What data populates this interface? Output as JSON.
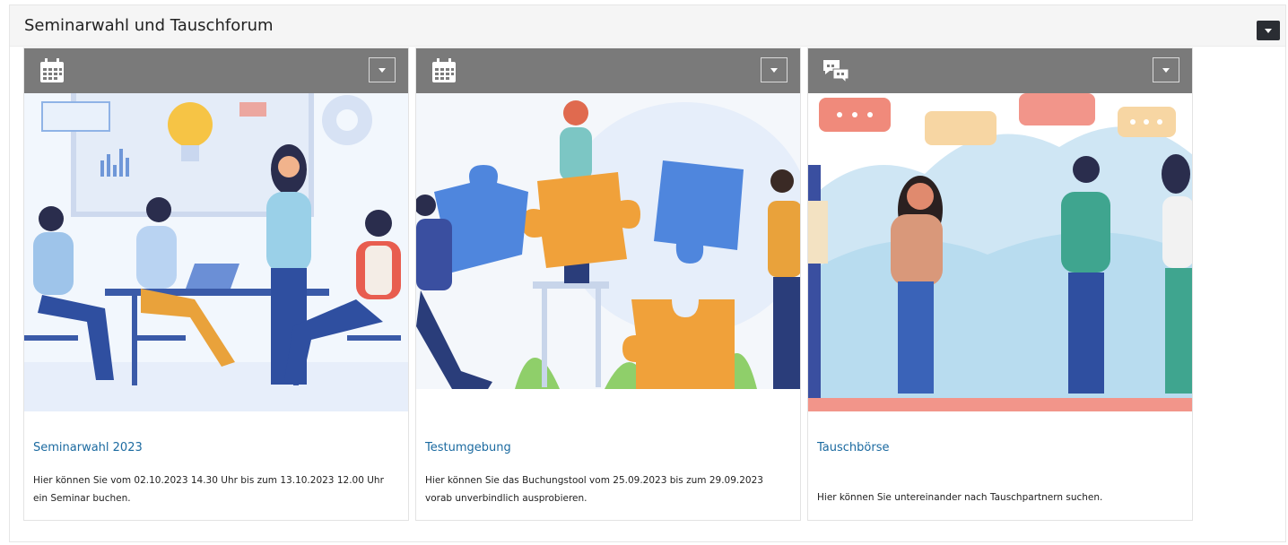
{
  "panel": {
    "title": "Seminarwahl und Tauschforum"
  },
  "cards": [
    {
      "title": "Seminarwahl 2023",
      "description": "Hier können Sie vom 02.10.2023 14.30 Uhr bis zum 13.10.2023 12.00 Uhr ein Seminar buchen.",
      "type_icon": "calendar-icon"
    },
    {
      "title": "Testumgebung",
      "description": "Hier können Sie das Buchungstool vom 25.09.2023 bis zum 29.09.2023 vorab unverbindlich ausprobieren.",
      "type_icon": "calendar-icon"
    },
    {
      "title": "Tauschbörse",
      "description": "Hier können Sie untereinander nach Tauschpartnern suchen.",
      "type_icon": "chat-bubbles-icon"
    }
  ],
  "colors": {
    "card_header": "#7a7a7a",
    "link": "#1b6aa0",
    "panel_menu": "#2a2d33"
  }
}
